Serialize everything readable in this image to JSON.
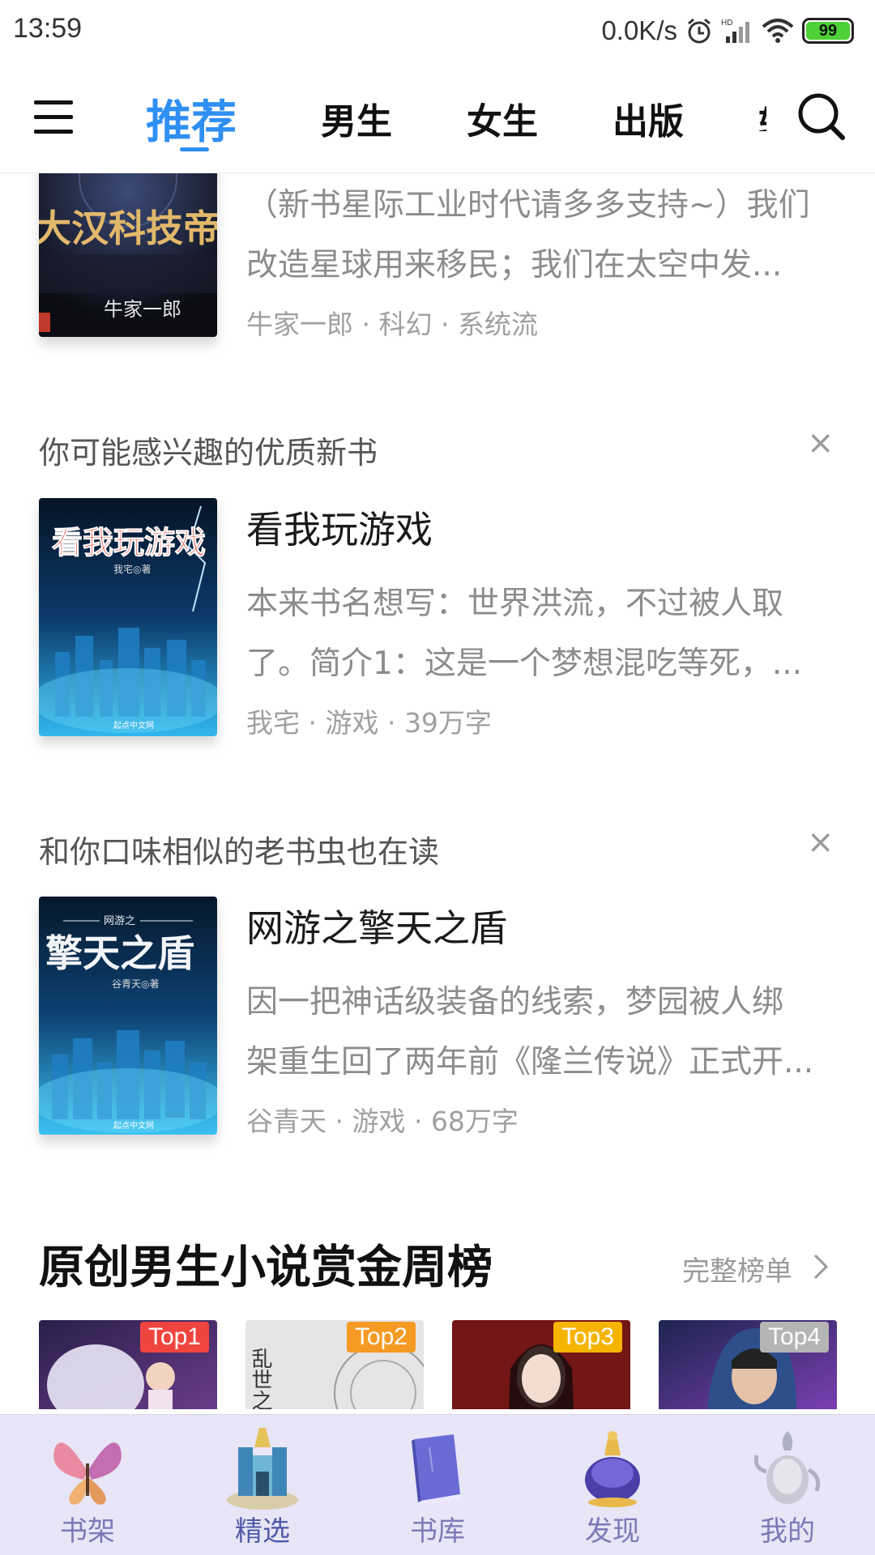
{
  "status_bar": {
    "time": "13:59",
    "net_speed": "0.0K/s",
    "battery": "99"
  },
  "top_nav": {
    "tabs": [
      {
        "label": "推荐",
        "active": true
      },
      {
        "label": "男生"
      },
      {
        "label": "女生"
      },
      {
        "label": "出版"
      }
    ]
  },
  "books": {
    "first": {
      "cover_title": "大汉科技帝国",
      "cover_author": "牛家一郎",
      "desc_line1": "（新书星际工业时代请多多支持~）我们",
      "desc_line2": "改造星球用来移民；我们在太空中发...",
      "meta": "牛家一郎 · 科幻 · 系统流"
    },
    "second": {
      "section_label": "你可能感兴趣的优质新书",
      "close": "×",
      "cover_title": "看我玩游戏",
      "cover_author": "我宅◎著",
      "cover_publisher": "起点中文网",
      "title": "看我玩游戏",
      "desc_line1": "本来书名想写：世界洪流，不过被人取",
      "desc_line2": "了。简介1：这是一个梦想混吃等死，...",
      "meta": "我宅 · 游戏 · 39万字"
    },
    "third": {
      "section_label": "和你口味相似的老书虫也在读",
      "close": "×",
      "cover_subtitle": "网游之",
      "cover_title": "擎天之盾",
      "cover_author": "谷青天◎著",
      "cover_publisher": "起点中文网",
      "title": "网游之擎天之盾",
      "desc_line1": "因一把神话级装备的线索，梦园被人绑",
      "desc_line2": "架重生回了两年前《隆兰传说》正式开...",
      "meta": "谷青天 · 游戏 · 68万字"
    }
  },
  "ranking": {
    "title": "原创男生小说赏金周榜",
    "more": "完整榜单",
    "cards": [
      {
        "badge": "Top1",
        "color": "#f0443f"
      },
      {
        "badge": "Top2",
        "color": "#f59a23"
      },
      {
        "badge": "Top3",
        "color": "#f5b400"
      },
      {
        "badge": "Top4",
        "color": "#b5b5b5"
      }
    ],
    "card2_text": "乱世之金"
  },
  "bottom_nav": {
    "items": [
      {
        "label": "书架"
      },
      {
        "label": "精选",
        "active": true
      },
      {
        "label": "书库"
      },
      {
        "label": "发现"
      },
      {
        "label": "我的"
      }
    ]
  }
}
